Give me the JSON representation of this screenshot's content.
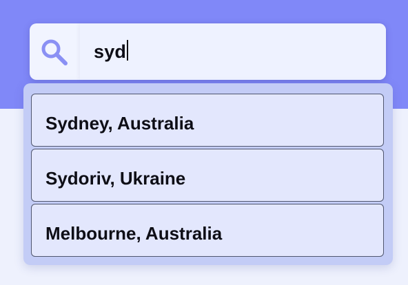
{
  "search": {
    "value": "syd",
    "icon": "search-icon",
    "icon_color": "#8a90f4"
  },
  "suggestions": [
    {
      "label": "Sydney, Australia"
    },
    {
      "label": "Sydoriv, Ukraine"
    },
    {
      "label": "Melbourne, Australia"
    }
  ],
  "colors": {
    "header_band": "#8088f8",
    "page_background": "#eef1fd",
    "dropdown_background": "#c3ccf6",
    "suggestion_background": "#e3e7fd"
  }
}
